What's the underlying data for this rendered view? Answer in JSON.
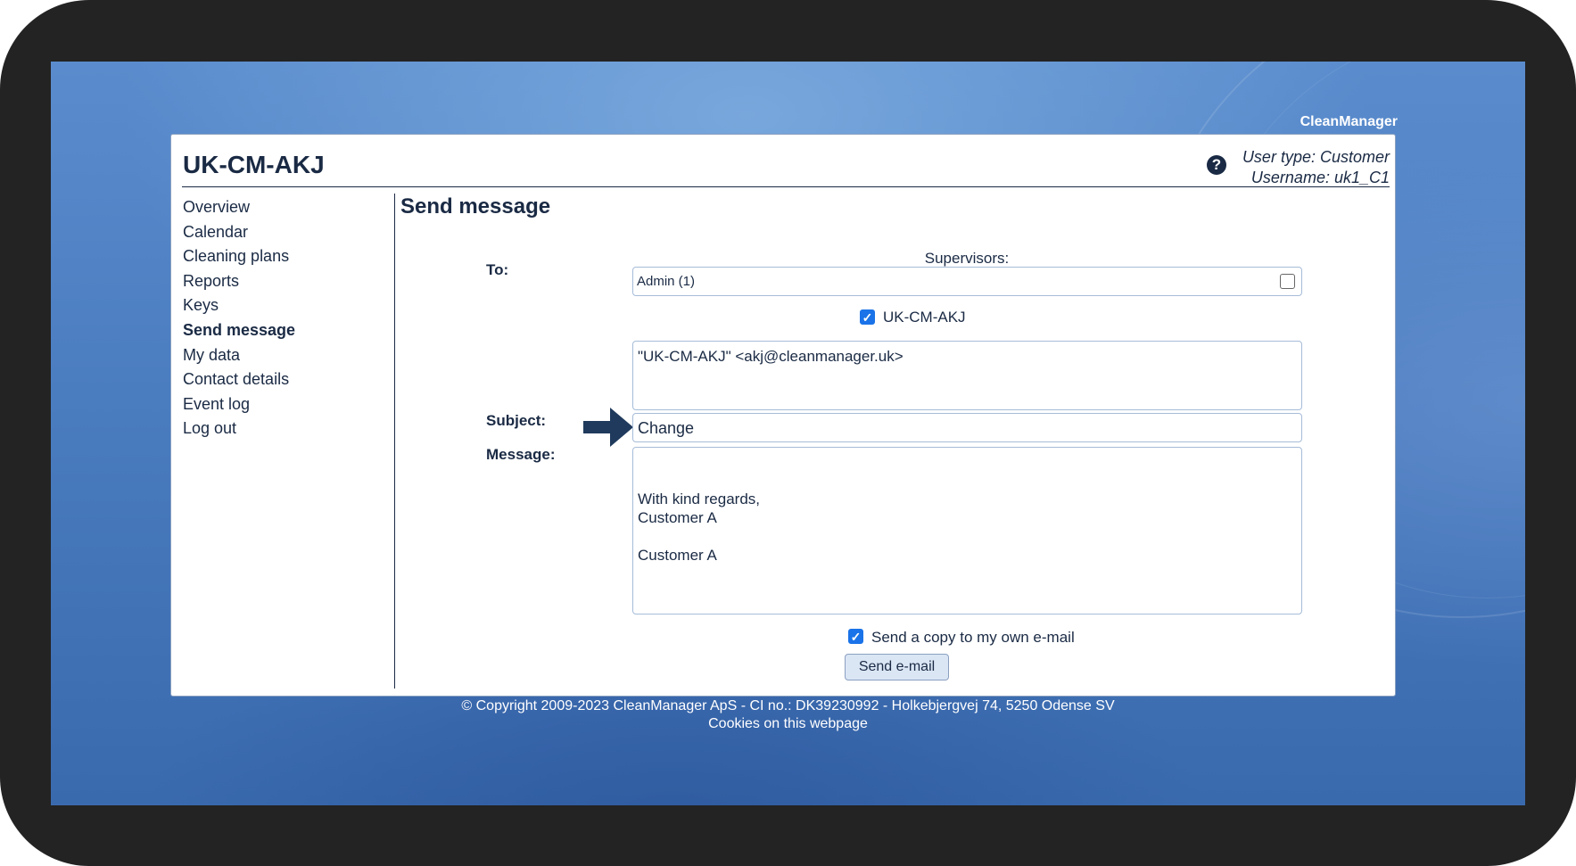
{
  "brand": "CleanManager",
  "header": {
    "site_title": "UK-CM-AKJ",
    "user_type": "User type: Customer",
    "username": "Username: uk1_C1",
    "help_icon": "question-circle-icon"
  },
  "nav": {
    "items": [
      {
        "label": "Overview"
      },
      {
        "label": "Calendar"
      },
      {
        "label": "Cleaning plans"
      },
      {
        "label": "Reports"
      },
      {
        "label": "Keys"
      },
      {
        "label": "Send message"
      },
      {
        "label": "My data"
      },
      {
        "label": "Contact details"
      },
      {
        "label": "Event log"
      },
      {
        "label": "Log out"
      }
    ],
    "active": "Send message"
  },
  "form": {
    "title": "Send message",
    "to_label": "To:",
    "supervisors_label": "Supervisors:",
    "supervisor_option": "Admin (1)",
    "supervisor_checked": false,
    "recipient_label": "UK-CM-AKJ",
    "recipient_checked": true,
    "recipient_address": "\"UK-CM-AKJ\" <akj@cleanmanager.uk>",
    "subject_label": "Subject:",
    "subject_value": "Change",
    "message_label": "Message:",
    "message_value": "With kind regards,\nCustomer A\n\nCustomer A",
    "copy_label": "Send a copy to my own e-mail",
    "copy_checked": true,
    "send_button": "Send e-mail"
  },
  "footer": {
    "copyright": "© Copyright 2009-2023 CleanManager ApS - CI no.: DK39230992 - Holkebjergvej 74, 5250 Odense SV",
    "cookies": "Cookies on this webpage"
  },
  "colors": {
    "text": "#1a2a44",
    "accent": "#1a73e8",
    "background": "#4a7cc0"
  }
}
